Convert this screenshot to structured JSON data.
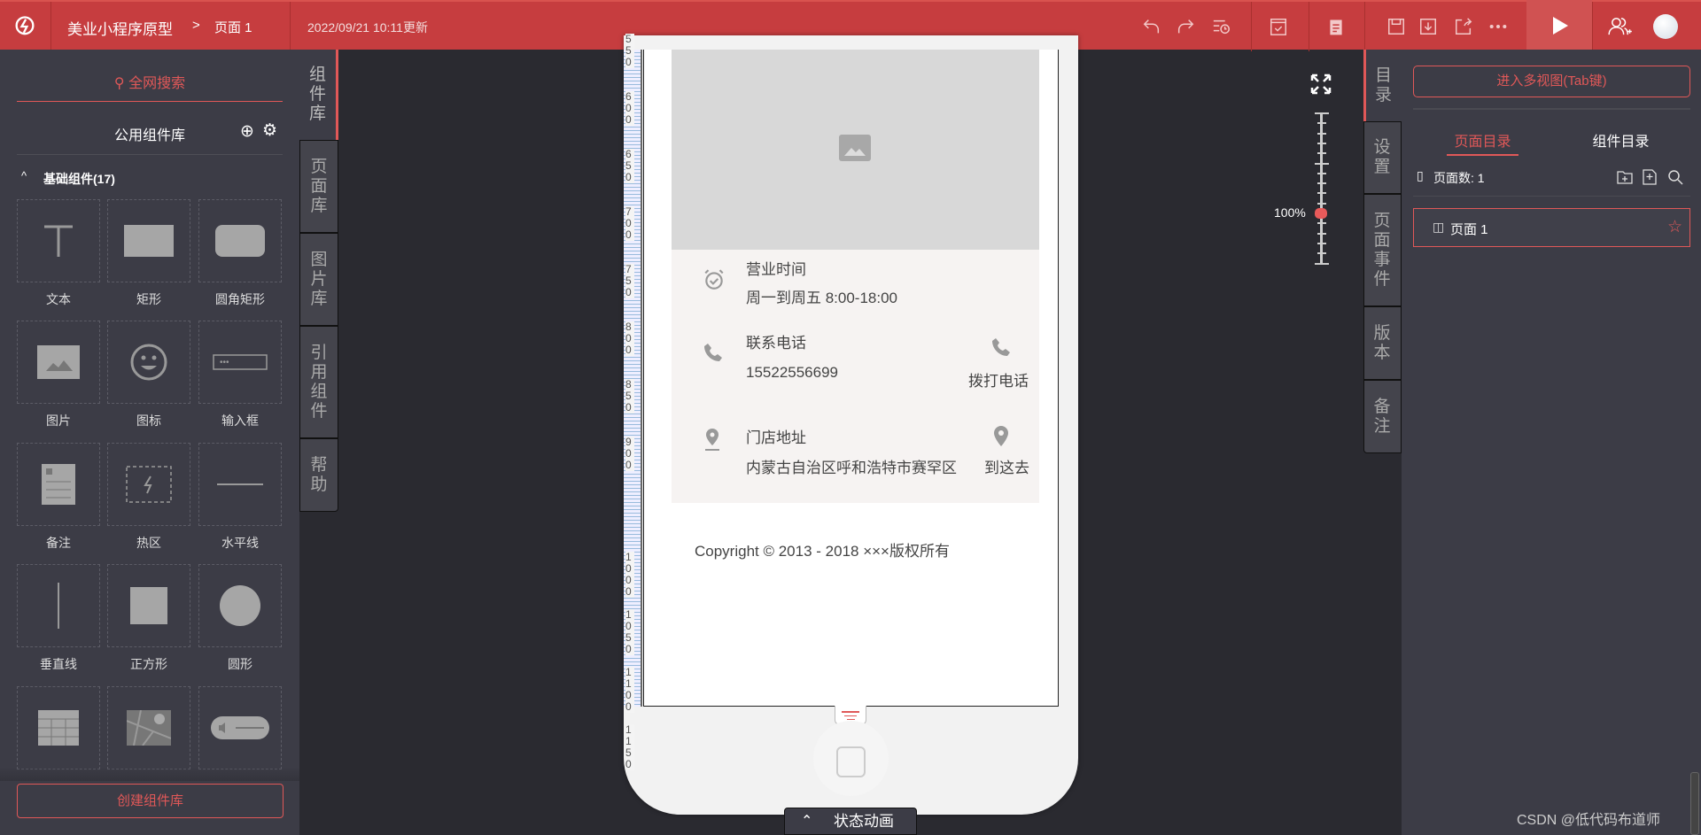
{
  "header": {
    "project": "美业小程序原型",
    "breadcrumb_sep": ">",
    "page": "页面 1",
    "updated": "2022/09/21 10:11更新",
    "icons": [
      "logo-icon",
      "undo-icon",
      "redo-icon",
      "history-icon",
      "check-icon",
      "clipboard-icon",
      "save-icon",
      "download-icon",
      "share-icon",
      "more-icon",
      "play-icon",
      "add-user-icon",
      "avatar"
    ]
  },
  "left": {
    "search": "全网搜索",
    "library_title": "公用组件库",
    "group": "基础组件(17)",
    "components": [
      "文本",
      "矩形",
      "圆角矩形",
      "图片",
      "图标",
      "输入框",
      "备注",
      "热区",
      "水平线",
      "垂直线",
      "正方形",
      "圆形",
      "表格",
      "地图",
      "音频"
    ],
    "create_button": "创建组件库"
  },
  "left_tabs": [
    "组件库",
    "页面库",
    "图片库",
    "引用组件",
    "帮助"
  ],
  "phone": {
    "hours_label": "营业时间",
    "hours_value": "周一到周五 8:00-18:00",
    "phone_label": "联系电话",
    "phone_value": "15522556699",
    "call_label": "拨打电话",
    "address_label": "门店地址",
    "address_value": "内蒙古自治区呼和浩特市赛罕区",
    "go_label": "到这去",
    "copyright": "Copyright © 2013 - 2018 ×××版权所有",
    "ruler_ticks": [
      "550",
      "600",
      "650",
      "700",
      "750",
      "800",
      "850",
      "900",
      "1000",
      "1050",
      "1100",
      "1150"
    ]
  },
  "zoom": {
    "label": "100%",
    "value_percent": 100
  },
  "bottom_tab": "状态动画",
  "right_tabs": [
    "目录",
    "设置",
    "页面事件",
    "版本",
    "备注"
  ],
  "right": {
    "multiview": "进入多视图(Tab键)",
    "tab_pages": "页面目录",
    "tab_components": "组件目录",
    "page_count": "页面数: 1",
    "page_item": "页面 1"
  },
  "watermark": "CSDN @低代码布道师",
  "colors": {
    "accent": "#c63d3f",
    "active": "#e05858",
    "panel": "#3c3c46",
    "canvas": "#2a2a30"
  }
}
